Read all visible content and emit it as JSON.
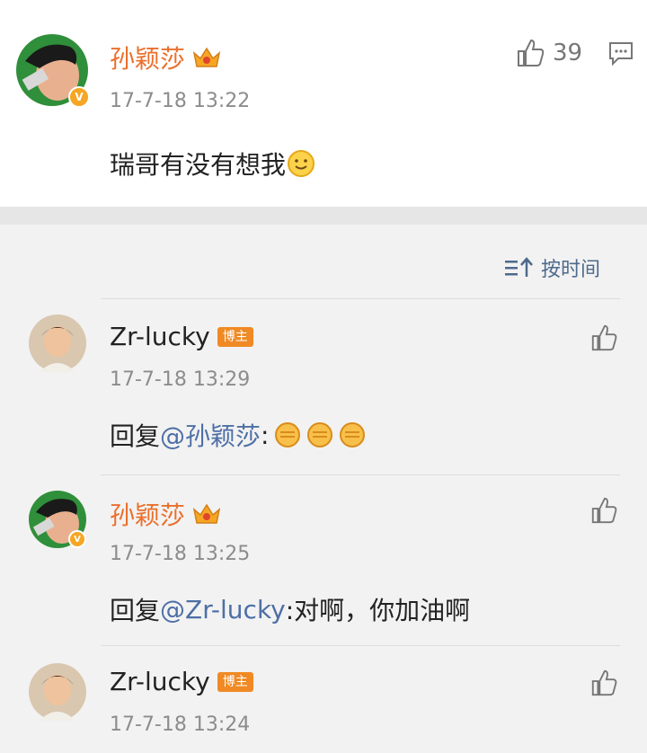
{
  "post": {
    "author": "孙颖莎",
    "time": "17-7-18 13:22",
    "text": "瑞哥有没有想我",
    "likes": "39"
  },
  "sort": {
    "label": "按时间"
  },
  "comments": [
    {
      "author": "Zr-lucky",
      "badge": "博主",
      "time": "17-7-18 13:29",
      "prefix": "回复",
      "mention": "@孙颖莎",
      "body": ":"
    },
    {
      "author": "孙颖莎",
      "time": "17-7-18 13:25",
      "prefix": "回复",
      "mention": "@Zr-lucky",
      "body": ":对啊，你加油啊"
    },
    {
      "author": "Zr-lucky",
      "badge": "博主",
      "time": "17-7-18 13:24"
    }
  ],
  "colors": {
    "orange_name": "#eb6f2c",
    "mention": "#4d6fa6",
    "badge": "#f08a24",
    "verified": "#f5a623"
  }
}
